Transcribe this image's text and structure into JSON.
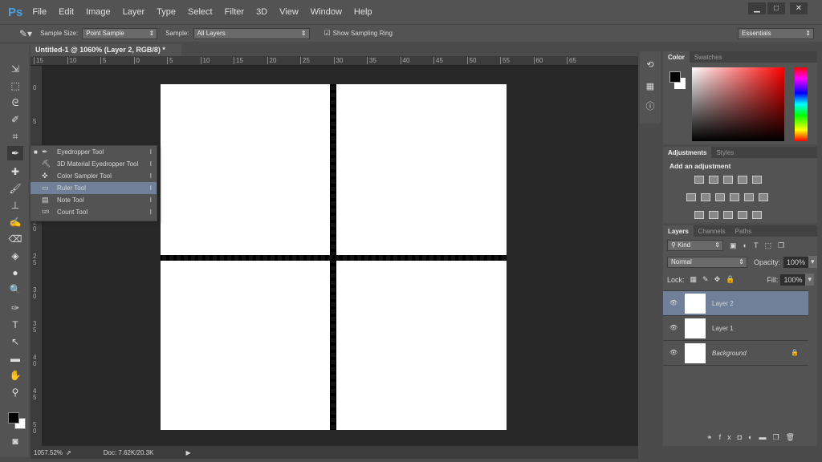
{
  "app": {
    "logo": "Ps",
    "menu": [
      "File",
      "Edit",
      "Image",
      "Layer",
      "Type",
      "Select",
      "Filter",
      "3D",
      "View",
      "Window",
      "Help"
    ],
    "window_buttons": [
      "▁",
      "□",
      "✕"
    ]
  },
  "options": {
    "sample_size_label": "Sample Size:",
    "sample_size": "Point Sample",
    "sample_label": "Sample:",
    "sample": "All Layers",
    "show_ring": "Show Sampling Ring",
    "show_ring_checked": true,
    "workspace": "Essentials"
  },
  "document": {
    "tab_title": "Untitled-1 @ 1060% (Layer 2, RGB/8) *",
    "close": "×",
    "zoom": "1057.52%",
    "doc_info": "Doc: 7.62K/20.3K"
  },
  "rulers": {
    "horizontal": [
      "15",
      "10",
      "5",
      "0",
      "5",
      "10",
      "15",
      "20",
      "25",
      "30",
      "35",
      "40",
      "45",
      "50",
      "55",
      "60",
      "65"
    ],
    "vertical": [
      "0",
      "5",
      "1 0",
      "1 5",
      "2 0",
      "2 5",
      "3 0",
      "3 5",
      "4 0",
      "4 5",
      "5 0"
    ]
  },
  "flyout": {
    "items": [
      {
        "icon": "eyedropper-icon",
        "label": "Eyedropper Tool",
        "key": "I",
        "active": true
      },
      {
        "icon": "3d-eyedropper-icon",
        "label": "3D Material Eyedropper Tool",
        "key": "I"
      },
      {
        "icon": "color-sampler-icon",
        "label": "Color Sampler Tool",
        "key": "I"
      },
      {
        "icon": "ruler-icon",
        "label": "Ruler Tool",
        "key": "I",
        "hovered": true
      },
      {
        "icon": "note-icon",
        "label": "Note Tool",
        "key": "I"
      },
      {
        "icon": "count-icon",
        "label": "Count Tool",
        "key": "I"
      }
    ]
  },
  "color_panel": {
    "tabs": [
      "Color",
      "Swatches"
    ],
    "foreground": "#000000",
    "background": "#ffffff",
    "hue": "#ff0000"
  },
  "adjustments": {
    "tabs": [
      "Adjustments",
      "Styles"
    ],
    "title": "Add an adjustment"
  },
  "layers_panel": {
    "tabs": [
      "Layers",
      "Channels",
      "Paths"
    ],
    "filter": "Kind",
    "blend_mode": "Normal",
    "opacity_label": "Opacity:",
    "opacity": "100%",
    "lock_label": "Lock:",
    "fill_label": "Fill:",
    "fill": "100%",
    "layers": [
      {
        "name": "Layer 2",
        "selected": true,
        "transparent": true
      },
      {
        "name": "Layer 1",
        "transparent": true
      },
      {
        "name": "Background",
        "locked": true
      }
    ]
  }
}
